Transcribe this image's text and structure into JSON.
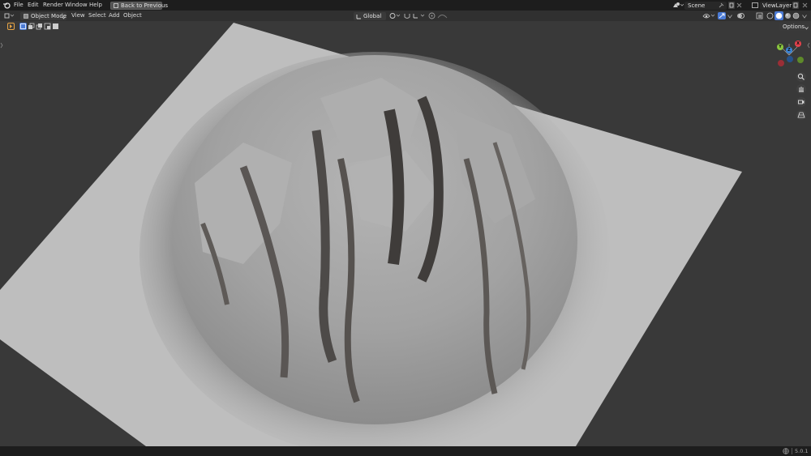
{
  "topbar": {
    "menus": [
      "File",
      "Edit",
      "Render",
      "Window",
      "Help"
    ],
    "back_button": "Back to Previous",
    "scene_name": "Scene",
    "view_layer": "ViewLayer"
  },
  "header": {
    "mode": "Object Mode",
    "menus": [
      "View",
      "Select",
      "Add",
      "Object"
    ],
    "transform_orientation": "Global",
    "options_label": "Options"
  },
  "status": {
    "version": "5.0.1"
  },
  "gizmo": {
    "x_label": "X",
    "y_label": "Y",
    "z_label": "Z",
    "x_color": "#e5414b",
    "y_color": "#8ac73f",
    "z_color": "#3b85d6"
  },
  "colors": {
    "accent": "#4b7bd6",
    "surface": "#bebebe",
    "topbar": "#1d1d1d",
    "header": "#303030"
  }
}
